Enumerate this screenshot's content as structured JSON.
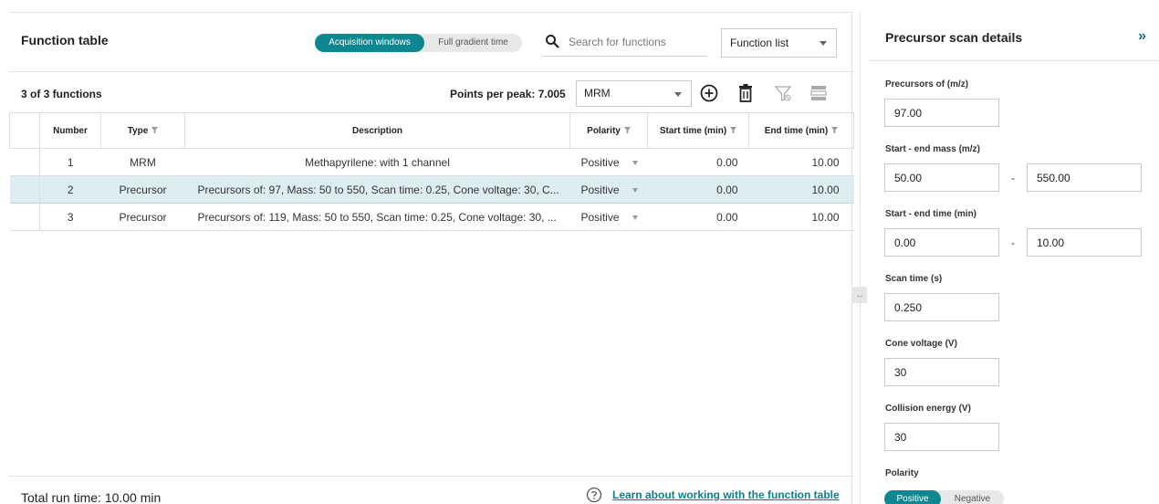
{
  "function_table": {
    "title": "Function table",
    "view_toggle": {
      "options": [
        "Acquisition windows",
        "Full gradient time"
      ],
      "selected": "Acquisition windows"
    },
    "search": {
      "placeholder": "Search for functions",
      "value": ""
    },
    "view_select": {
      "value": "Function list"
    },
    "toolbar": {
      "count": "3 of 3 functions",
      "points_per_peak_label": "Points per peak: 7.005",
      "type_select": "MRM",
      "icons": [
        "add-icon",
        "delete-icon",
        "clear-filter-icon",
        "columns-icon"
      ]
    },
    "columns": [
      "Number",
      "Type",
      "Description",
      "Polarity",
      "Start time (min)",
      "End time (min)"
    ],
    "rows": [
      {
        "number": "1",
        "type": "MRM",
        "description": "Methapyrilene: with 1 channel",
        "polarity": "Positive",
        "start": "0.00",
        "end": "10.00",
        "selected": false
      },
      {
        "number": "2",
        "type": "Precursor",
        "description": "Precursors of: 97, Mass: 50 to 550, Scan time: 0.25, Cone voltage: 30, C...",
        "polarity": "Positive",
        "start": "0.00",
        "end": "10.00",
        "selected": true
      },
      {
        "number": "3",
        "type": "Precursor",
        "description": "Precursors of: 119, Mass: 50 to 550, Scan time: 0.25, Cone voltage: 30, ...",
        "polarity": "Positive",
        "start": "0.00",
        "end": "10.00",
        "selected": false
      }
    ],
    "footer": {
      "total_run_time": "Total run time: 10.00 min",
      "help_link": "Learn about working with the function table"
    }
  },
  "details": {
    "title": "Precursor scan details",
    "collapse_glyph": "»",
    "precursors_label": "Precursors of (m/z)",
    "precursors_value": "97.00",
    "mass_label": "Start - end mass (m/z)",
    "mass_start": "50.00",
    "mass_end": "550.00",
    "time_label": "Start - end time (min)",
    "time_start": "0.00",
    "time_end": "10.00",
    "scan_label": "Scan time (s)",
    "scan_value": "0.250",
    "cone_label": "Cone voltage (V)",
    "cone_value": "30",
    "collision_label": "Collision energy (V)",
    "collision_value": "30",
    "polarity_label": "Polarity",
    "polarity_options": [
      "Positive",
      "Negative"
    ],
    "polarity_selected": "Positive",
    "range_dash": "-"
  },
  "colors": {
    "accent": "#0f8791",
    "selected_row": "#deeef0",
    "link": "#0f7f89"
  }
}
